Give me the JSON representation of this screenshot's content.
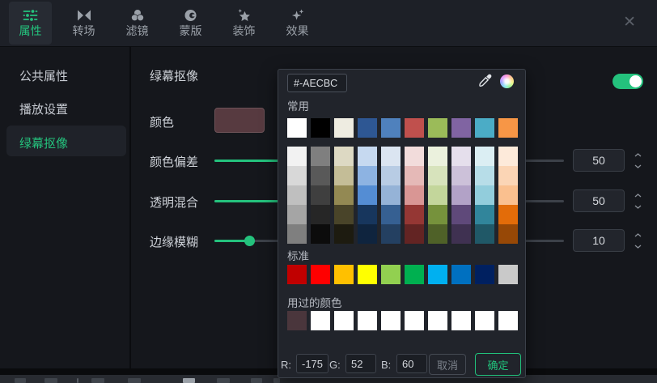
{
  "header": {
    "tabs": [
      {
        "label": "属性",
        "active": true
      },
      {
        "label": "转场",
        "active": false
      },
      {
        "label": "滤镜",
        "active": false
      },
      {
        "label": "蒙版",
        "active": false
      },
      {
        "label": "装饰",
        "active": false
      },
      {
        "label": "效果",
        "active": false
      }
    ],
    "close_icon": "✕"
  },
  "sidebar": {
    "items": [
      {
        "label": "公共属性",
        "active": false
      },
      {
        "label": "播放设置",
        "active": false
      },
      {
        "label": "绿幕抠像",
        "active": true
      }
    ]
  },
  "panel": {
    "keying_label": "绿幕抠像",
    "toggle_on": true,
    "color_label": "颜色",
    "color_value": "#573A40",
    "sliders": [
      {
        "label": "颜色偏差",
        "value": "50",
        "max": 100
      },
      {
        "label": "透明混合",
        "value": "50",
        "max": 100
      },
      {
        "label": "边缘模糊",
        "value": "10",
        "max": 100
      }
    ]
  },
  "color_picker": {
    "hex_value": "#-AECBC",
    "common_label": "常用",
    "standard_label": "标准",
    "used_label": "用过的颜色",
    "theme_colors": [
      "#FFFFFF",
      "#000000",
      "#EEECE1",
      "#2E5793",
      "#4F81BD",
      "#C0504D",
      "#9BBB59",
      "#8064A2",
      "#4BACC6",
      "#F79646"
    ],
    "variant_rows": [
      [
        "#F2F2F2",
        "#7F7F7F",
        "#DDD9C3",
        "#C6D9F0",
        "#DBE5F1",
        "#F2DCDB",
        "#EBF1DD",
        "#E5DFEC",
        "#DBEEF3",
        "#FDEADA"
      ],
      [
        "#D8D8D8",
        "#595959",
        "#C4BD97",
        "#8DB3E2",
        "#B8CCE4",
        "#E5B9B7",
        "#D7E3BC",
        "#CCC1D9",
        "#B7DDE8",
        "#FBD5B5"
      ],
      [
        "#BFBFBF",
        "#3F3F3F",
        "#938953",
        "#548DD4",
        "#95B3D7",
        "#D99694",
        "#C3D69B",
        "#B2A2C7",
        "#92CDDC",
        "#FAC08F"
      ],
      [
        "#A5A5A5",
        "#262626",
        "#494429",
        "#17365D",
        "#366092",
        "#953734",
        "#76923C",
        "#5F497A",
        "#31859B",
        "#E36C09"
      ],
      [
        "#7F7F7F",
        "#0C0C0C",
        "#1D1B10",
        "#0F243E",
        "#244061",
        "#632423",
        "#4F6128",
        "#3F3151",
        "#205867",
        "#974806"
      ]
    ],
    "standard_colors": [
      "#C00000",
      "#FF0000",
      "#FFC000",
      "#FFFF00",
      "#92D050",
      "#00B050",
      "#00B0F0",
      "#0070C0",
      "#002060",
      "#C9C9C9"
    ],
    "used_colors": [
      "#4A363C",
      "#FFFFFF",
      "#FFFFFF",
      "#FFFFFF",
      "#FFFFFF",
      "#FFFFFF",
      "#FFFFFF",
      "#FFFFFF",
      "#FFFFFF",
      "#FFFFFF"
    ],
    "rgb": {
      "r_label": "R:",
      "r_value": "-175",
      "g_label": "G:",
      "g_value": "52",
      "b_label": "B:",
      "b_value": "60"
    },
    "cancel_label": "取消",
    "confirm_label": "确定"
  },
  "colors": {
    "accent": "#24C27D",
    "confirm_green": "#21C17B"
  }
}
